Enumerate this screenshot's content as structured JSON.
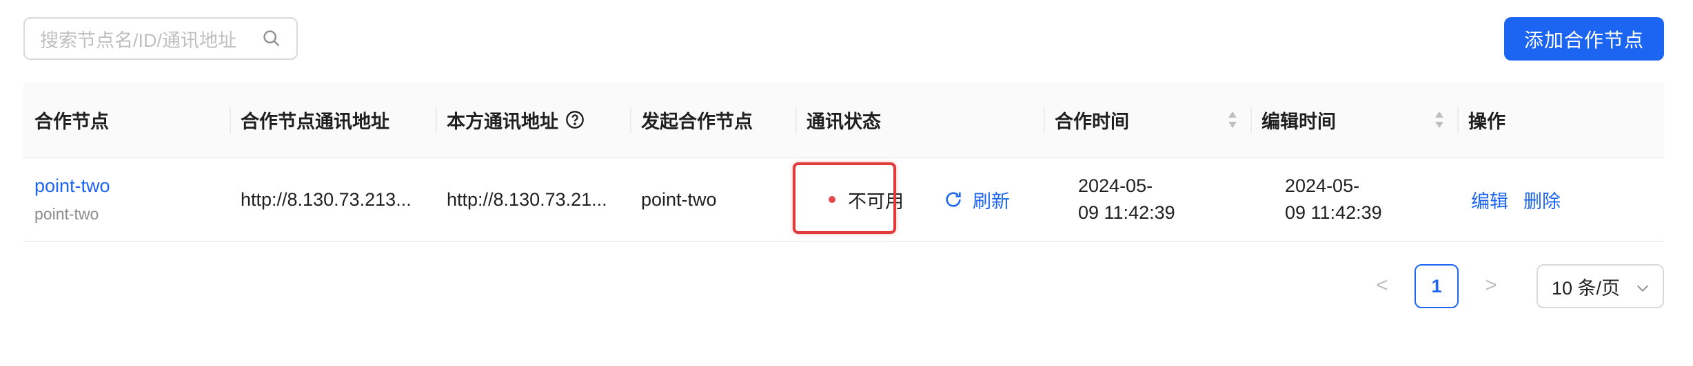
{
  "search": {
    "placeholder": "搜索节点名/ID/通讯地址",
    "icon": "search-icon"
  },
  "add_button": {
    "label": "添加合作节点"
  },
  "table": {
    "columns": [
      "合作节点",
      "合作节点通讯地址",
      "本方通讯地址",
      "发起合作节点",
      "通讯状态",
      "合作时间",
      "编辑时间",
      "操作"
    ],
    "rows": [
      {
        "node_name": "point-two",
        "node_id": "point-two",
        "partner_address": "http://8.130.73.213...",
        "local_address": "http://8.130.73.21...",
        "initiator": "point-two",
        "status": "不可用",
        "status_color": "#e5484d",
        "refresh_label": "刷新",
        "created_date": "2024-05-",
        "created_time": "09 11:42:39",
        "edited_date": "2024-05-",
        "edited_time": "09 11:42:39",
        "edit_label": "编辑",
        "delete_label": "删除"
      }
    ]
  },
  "pagination": {
    "prev": "<",
    "current": "1",
    "next": ">",
    "page_size": "10 条/页"
  },
  "colors": {
    "accent": "#1c64f2",
    "highlight_border": "#e03a3a"
  }
}
